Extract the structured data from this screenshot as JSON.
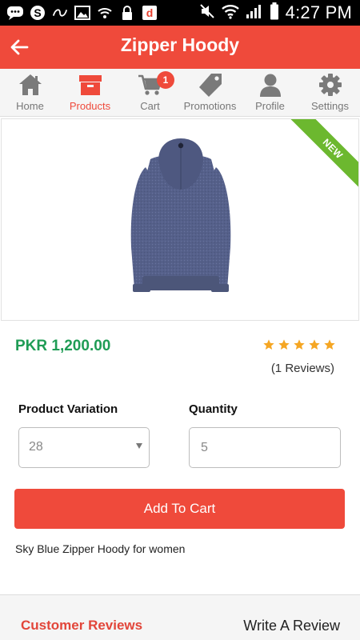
{
  "status_bar": {
    "time": "4:27 PM",
    "icons": [
      "chat-icon",
      "skype-icon",
      "link-icon",
      "image-icon",
      "wifi-icon",
      "lock-icon",
      "d-app-icon",
      "mute-icon",
      "signal-icon",
      "battery-icon"
    ]
  },
  "app_bar": {
    "title": "Zipper Hoody",
    "color": "#ef4a3b"
  },
  "nav": {
    "tabs": [
      {
        "label": "Home",
        "icon": "home-icon"
      },
      {
        "label": "Products",
        "icon": "box-icon",
        "active": true
      },
      {
        "label": "Cart",
        "icon": "cart-icon",
        "badge": "1"
      },
      {
        "label": "Promotions",
        "icon": "tag-icon"
      },
      {
        "label": "Profile",
        "icon": "person-icon"
      },
      {
        "label": "Settings",
        "icon": "gear-icon"
      }
    ]
  },
  "product": {
    "ribbon": "NEW",
    "price": "PKR 1,200.00",
    "rating": 5,
    "reviews_text": "(1 Reviews)",
    "variation_label": "Product Variation",
    "variation_value": "28",
    "quantity_label": "Quantity",
    "quantity_value": "5",
    "add_to_cart": "Add To Cart",
    "description": "Sky Blue Zipper Hoody for women"
  },
  "reviews": {
    "title": "Customer Reviews",
    "write_label": "Write A Review"
  },
  "colors": {
    "accent": "#ef4a3b",
    "price": "#1f9c55",
    "star": "#f5a623",
    "ribbon": "#6cb82f"
  }
}
